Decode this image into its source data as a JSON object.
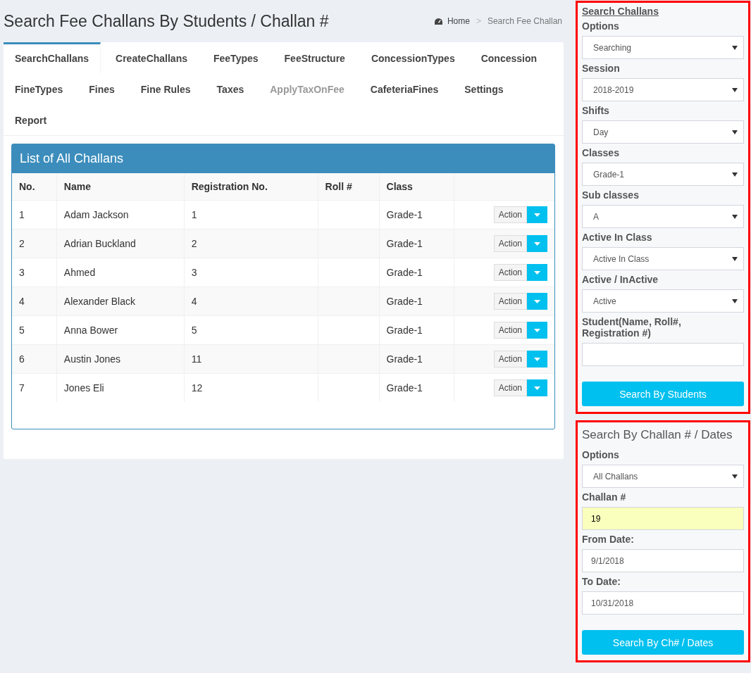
{
  "page_title": "Search Fee Challans By Students / Challan #",
  "breadcrumb_separator": ">",
  "breadcrumb": [
    {
      "label": "Home",
      "kind": "home"
    },
    {
      "label": "Search Fee Challan",
      "kind": "current"
    }
  ],
  "tabs": [
    {
      "label": "SearchChallans",
      "selected": true,
      "disabled": false
    },
    {
      "label": "CreateChallans",
      "selected": false,
      "disabled": false
    },
    {
      "label": "FeeTypes",
      "selected": false,
      "disabled": false
    },
    {
      "label": "FeeStructure",
      "selected": false,
      "disabled": false
    },
    {
      "label": "ConcessionTypes",
      "selected": false,
      "disabled": false
    },
    {
      "label": "Concession",
      "selected": false,
      "disabled": false
    },
    {
      "label": "FineTypes",
      "selected": false,
      "disabled": false
    },
    {
      "label": "Fines",
      "selected": false,
      "disabled": false
    },
    {
      "label": "Fine Rules",
      "selected": false,
      "disabled": false
    },
    {
      "label": "Taxes",
      "selected": false,
      "disabled": false
    },
    {
      "label": "ApplyTaxOnFee",
      "selected": false,
      "disabled": true
    },
    {
      "label": "CafeteriaFines",
      "selected": false,
      "disabled": false
    },
    {
      "label": "Settings",
      "selected": false,
      "disabled": false
    },
    {
      "label": "Report",
      "selected": false,
      "disabled": false
    }
  ],
  "table": {
    "title": "List of All Challans",
    "columns": [
      "No.",
      "Name",
      "Registration No.",
      "Roll #",
      "Class"
    ],
    "rows": [
      {
        "cells": [
          "1",
          "Adam Jackson",
          "1",
          "",
          "Grade-1"
        ],
        "action": "Action"
      },
      {
        "cells": [
          "2",
          "Adrian Buckland",
          "2",
          "",
          "Grade-1"
        ],
        "action": "Action"
      },
      {
        "cells": [
          "3",
          "Ahmed",
          "3",
          "",
          "Grade-1"
        ],
        "action": "Action"
      },
      {
        "cells": [
          "4",
          "Alexander Black",
          "4",
          "",
          "Grade-1"
        ],
        "action": "Action"
      },
      {
        "cells": [
          "5",
          "Anna Bower",
          "5",
          "",
          "Grade-1"
        ],
        "action": "Action"
      },
      {
        "cells": [
          "6",
          "Austin Jones",
          "11",
          "",
          "Grade-1"
        ],
        "action": "Action"
      },
      {
        "cells": [
          "7",
          "Jones Eli",
          "12",
          "",
          "Grade-1"
        ],
        "action": "Action"
      }
    ]
  },
  "student_search": {
    "title": "Search Challans",
    "fields": [
      {
        "label": "Options",
        "kind": "select",
        "value": "Searching",
        "highlighted": false
      },
      {
        "label": "Session",
        "kind": "select",
        "value": "2018-2019",
        "highlighted": false
      },
      {
        "label": "Shifts",
        "kind": "select",
        "value": "Day",
        "highlighted": false
      },
      {
        "label": "Classes",
        "kind": "select",
        "value": "Grade-1",
        "highlighted": false
      },
      {
        "label": "Sub classes",
        "kind": "select",
        "value": "A",
        "highlighted": false
      },
      {
        "label": "Active In Class",
        "kind": "select",
        "value": "Active In Class",
        "highlighted": false
      },
      {
        "label": "Active / InActive",
        "kind": "select",
        "value": "Active",
        "highlighted": false
      },
      {
        "label": "Student(Name, Roll#, Registration #)",
        "kind": "text",
        "highlighted": false
      }
    ],
    "button": "Search By Students"
  },
  "challan_search": {
    "title": "Search By Challan # / Dates",
    "fields": [
      {
        "label": "Options",
        "kind": "select",
        "value": "All Challans",
        "highlighted": false
      },
      {
        "label": "Challan #",
        "kind": "text",
        "value": "19",
        "highlighted": true
      },
      {
        "label": "From Date:",
        "kind": "text",
        "value": "9/1/2018",
        "highlighted": false
      },
      {
        "label": "To Date:",
        "kind": "text",
        "value": "10/31/2018",
        "highlighted": false
      }
    ],
    "button": "Search By Ch# / Dates"
  }
}
